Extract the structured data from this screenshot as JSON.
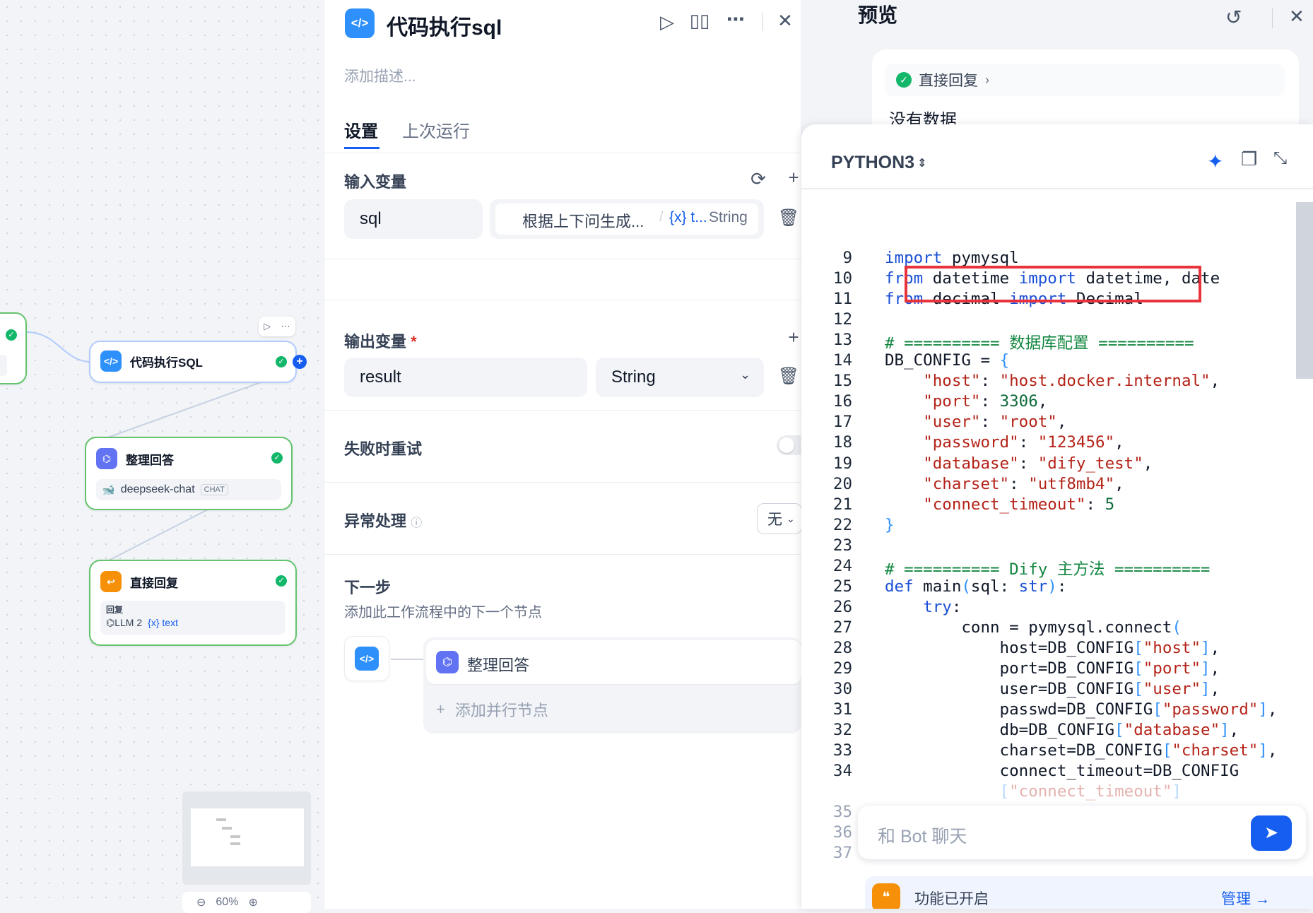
{
  "canvas": {
    "nodes": [
      {
        "title": "代码执行SQL",
        "icon": "code-icon",
        "color": "#2e90fa"
      },
      {
        "title": "整理回答",
        "icon": "llm-icon",
        "color": "#6172f3",
        "model": "deepseek-chat",
        "model_tag": "CHAT"
      },
      {
        "title": "直接回复",
        "icon": "reply-icon",
        "color": "#f79009",
        "field_label": "回复",
        "var_source": "LLM 2",
        "var_name": "text"
      }
    ],
    "zoom": "60%"
  },
  "panel": {
    "title": "代码执行sql",
    "description_placeholder": "添加描述...",
    "tabs": [
      "设置",
      "上次运行"
    ],
    "input_section": "输入变量",
    "input_var": {
      "name": "sql",
      "value": "根据上下问生成...",
      "source": "{x} t...",
      "type": "String"
    },
    "output_section": "输出变量",
    "required_mark": "*",
    "output_var": {
      "name": "result",
      "type": "String"
    },
    "retry_label": "失败时重试",
    "error_label": "异常处理",
    "error_value": "无",
    "next_title": "下一步",
    "next_desc": "添加此工作流程中的下一个节点",
    "next_node": "整理回答",
    "add_parallel": "添加并行节点"
  },
  "preview": {
    "title": "预览",
    "reply_chip": "直接回复",
    "no_data": "没有数据",
    "language": "PYTHON3",
    "chat_placeholder": "和 Bot 聊天",
    "feature_label": "功能已开启",
    "manage_label": "管理",
    "highlight_color": "#e8333c"
  },
  "code_lines": [
    {
      "n": "9",
      "t": "import pymysql"
    },
    {
      "n": "10",
      "t": "from datetime import datetime, date"
    },
    {
      "n": "11",
      "t": "from decimal import Decimal"
    },
    {
      "n": "12",
      "t": ""
    },
    {
      "n": "13",
      "t": "# ========== 数据库配置 =========="
    },
    {
      "n": "14",
      "t": "DB_CONFIG = {"
    },
    {
      "n": "15",
      "t": "    \"host\": \"host.docker.internal\","
    },
    {
      "n": "16",
      "t": "    \"port\": 3306,"
    },
    {
      "n": "17",
      "t": "    \"user\": \"root\","
    },
    {
      "n": "18",
      "t": "    \"password\": \"123456\","
    },
    {
      "n": "19",
      "t": "    \"database\": \"dify_test\","
    },
    {
      "n": "20",
      "t": "    \"charset\": \"utf8mb4\","
    },
    {
      "n": "21",
      "t": "    \"connect_timeout\": 5"
    },
    {
      "n": "22",
      "t": "}"
    },
    {
      "n": "23",
      "t": ""
    },
    {
      "n": "24",
      "t": "# ========== Dify 主方法 =========="
    },
    {
      "n": "25",
      "t": "def main(sql: str):"
    },
    {
      "n": "26",
      "t": "    try:"
    },
    {
      "n": "27",
      "t": "        conn = pymysql.connect("
    },
    {
      "n": "28",
      "t": "            host=DB_CONFIG[\"host\"],"
    },
    {
      "n": "29",
      "t": "            port=DB_CONFIG[\"port\"],"
    },
    {
      "n": "30",
      "t": "            user=DB_CONFIG[\"user\"],"
    },
    {
      "n": "31",
      "t": "            passwd=DB_CONFIG[\"password\"],"
    },
    {
      "n": "32",
      "t": "            db=DB_CONFIG[\"database\"],"
    },
    {
      "n": "33",
      "t": "            charset=DB_CONFIG[\"charset\"],"
    },
    {
      "n": "34",
      "t": "            connect_timeout=DB_CONFIG"
    },
    {
      "n": "",
      "t": "            [\"connect_timeout\"]"
    },
    {
      "n": "35",
      "t": ""
    },
    {
      "n": "36",
      "t": ""
    },
    {
      "n": "37",
      "t": ""
    }
  ]
}
